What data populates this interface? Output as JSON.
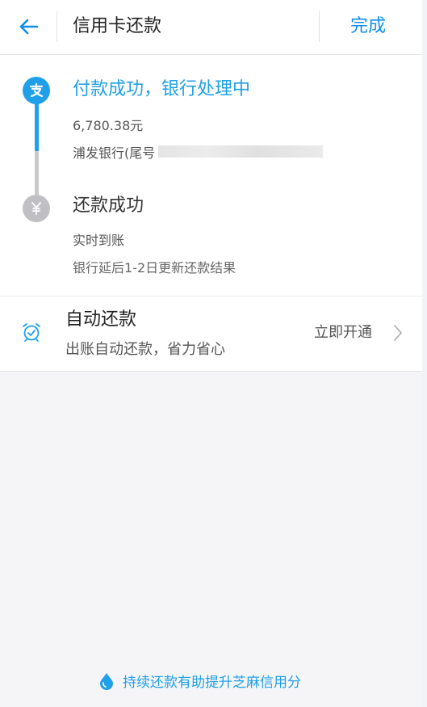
{
  "header": {
    "title": "信用卡还款",
    "done_label": "完成"
  },
  "progress": {
    "step1": {
      "title": "付款成功，银行处理中",
      "amount": "6,780.38元",
      "bank": "浦发银行(尾号"
    },
    "step2": {
      "title": "还款成功",
      "realtime": "实时到账",
      "note": "银行延后1-2日更新还款结果"
    },
    "node_icons": [
      "alipay-icon",
      "yuan-icon"
    ]
  },
  "auto_repay": {
    "title": "自动还款",
    "subtitle": "出账自动还款，省力省心",
    "action": "立即开通"
  },
  "footer": {
    "tip": "持续还款有助提升芝麻信用分"
  },
  "colors": {
    "accent": "#1fa0e8",
    "link": "#108ee9",
    "inactive": "#c0c0c4",
    "background": "#f5f5f7"
  }
}
